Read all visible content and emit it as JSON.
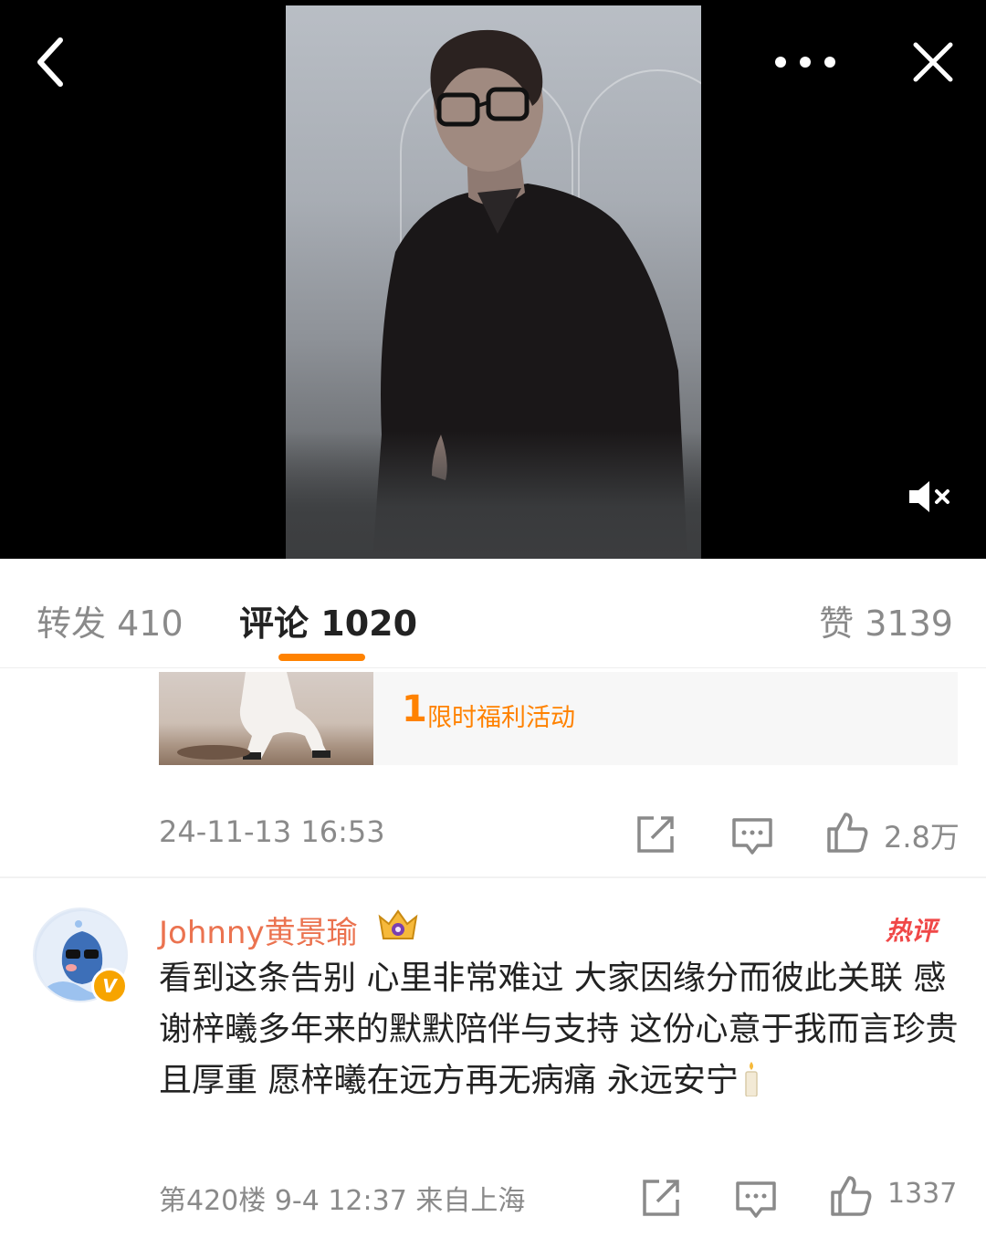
{
  "video": {
    "icons": [
      "back-arrow-icon",
      "more-dots-icon",
      "close-icon",
      "mute-icon"
    ]
  },
  "tabs": {
    "repost": {
      "label": "转发",
      "count": "410"
    },
    "comment": {
      "label": "评论",
      "count": "1020"
    },
    "like": {
      "label": "赞",
      "count": "3139"
    }
  },
  "accent_color": "#ff8200",
  "promo": {
    "rank": "1",
    "text": "限时福利活动"
  },
  "post": {
    "timestamp": "24-11-13 16:53",
    "likes": "2.8万",
    "icons": [
      "share-icon",
      "comment-icon",
      "like-icon"
    ]
  },
  "comment": {
    "author": "Johnny黄景瑜",
    "hot_badge": "热评",
    "verified_mark": "V",
    "text": "看到这条告别 心里非常难过 大家因缘分而彼此关联 感谢梓曦多年来的默默陪伴与支持 这份心意于我而言珍贵且厚重 愿梓曦在远方再无病痛 永远安宁",
    "floor": "第420楼",
    "time": "9-4 12:37",
    "location": "来自上海",
    "likes": "1337",
    "author_color": "#eb7350",
    "hot_color": "#f04848"
  }
}
